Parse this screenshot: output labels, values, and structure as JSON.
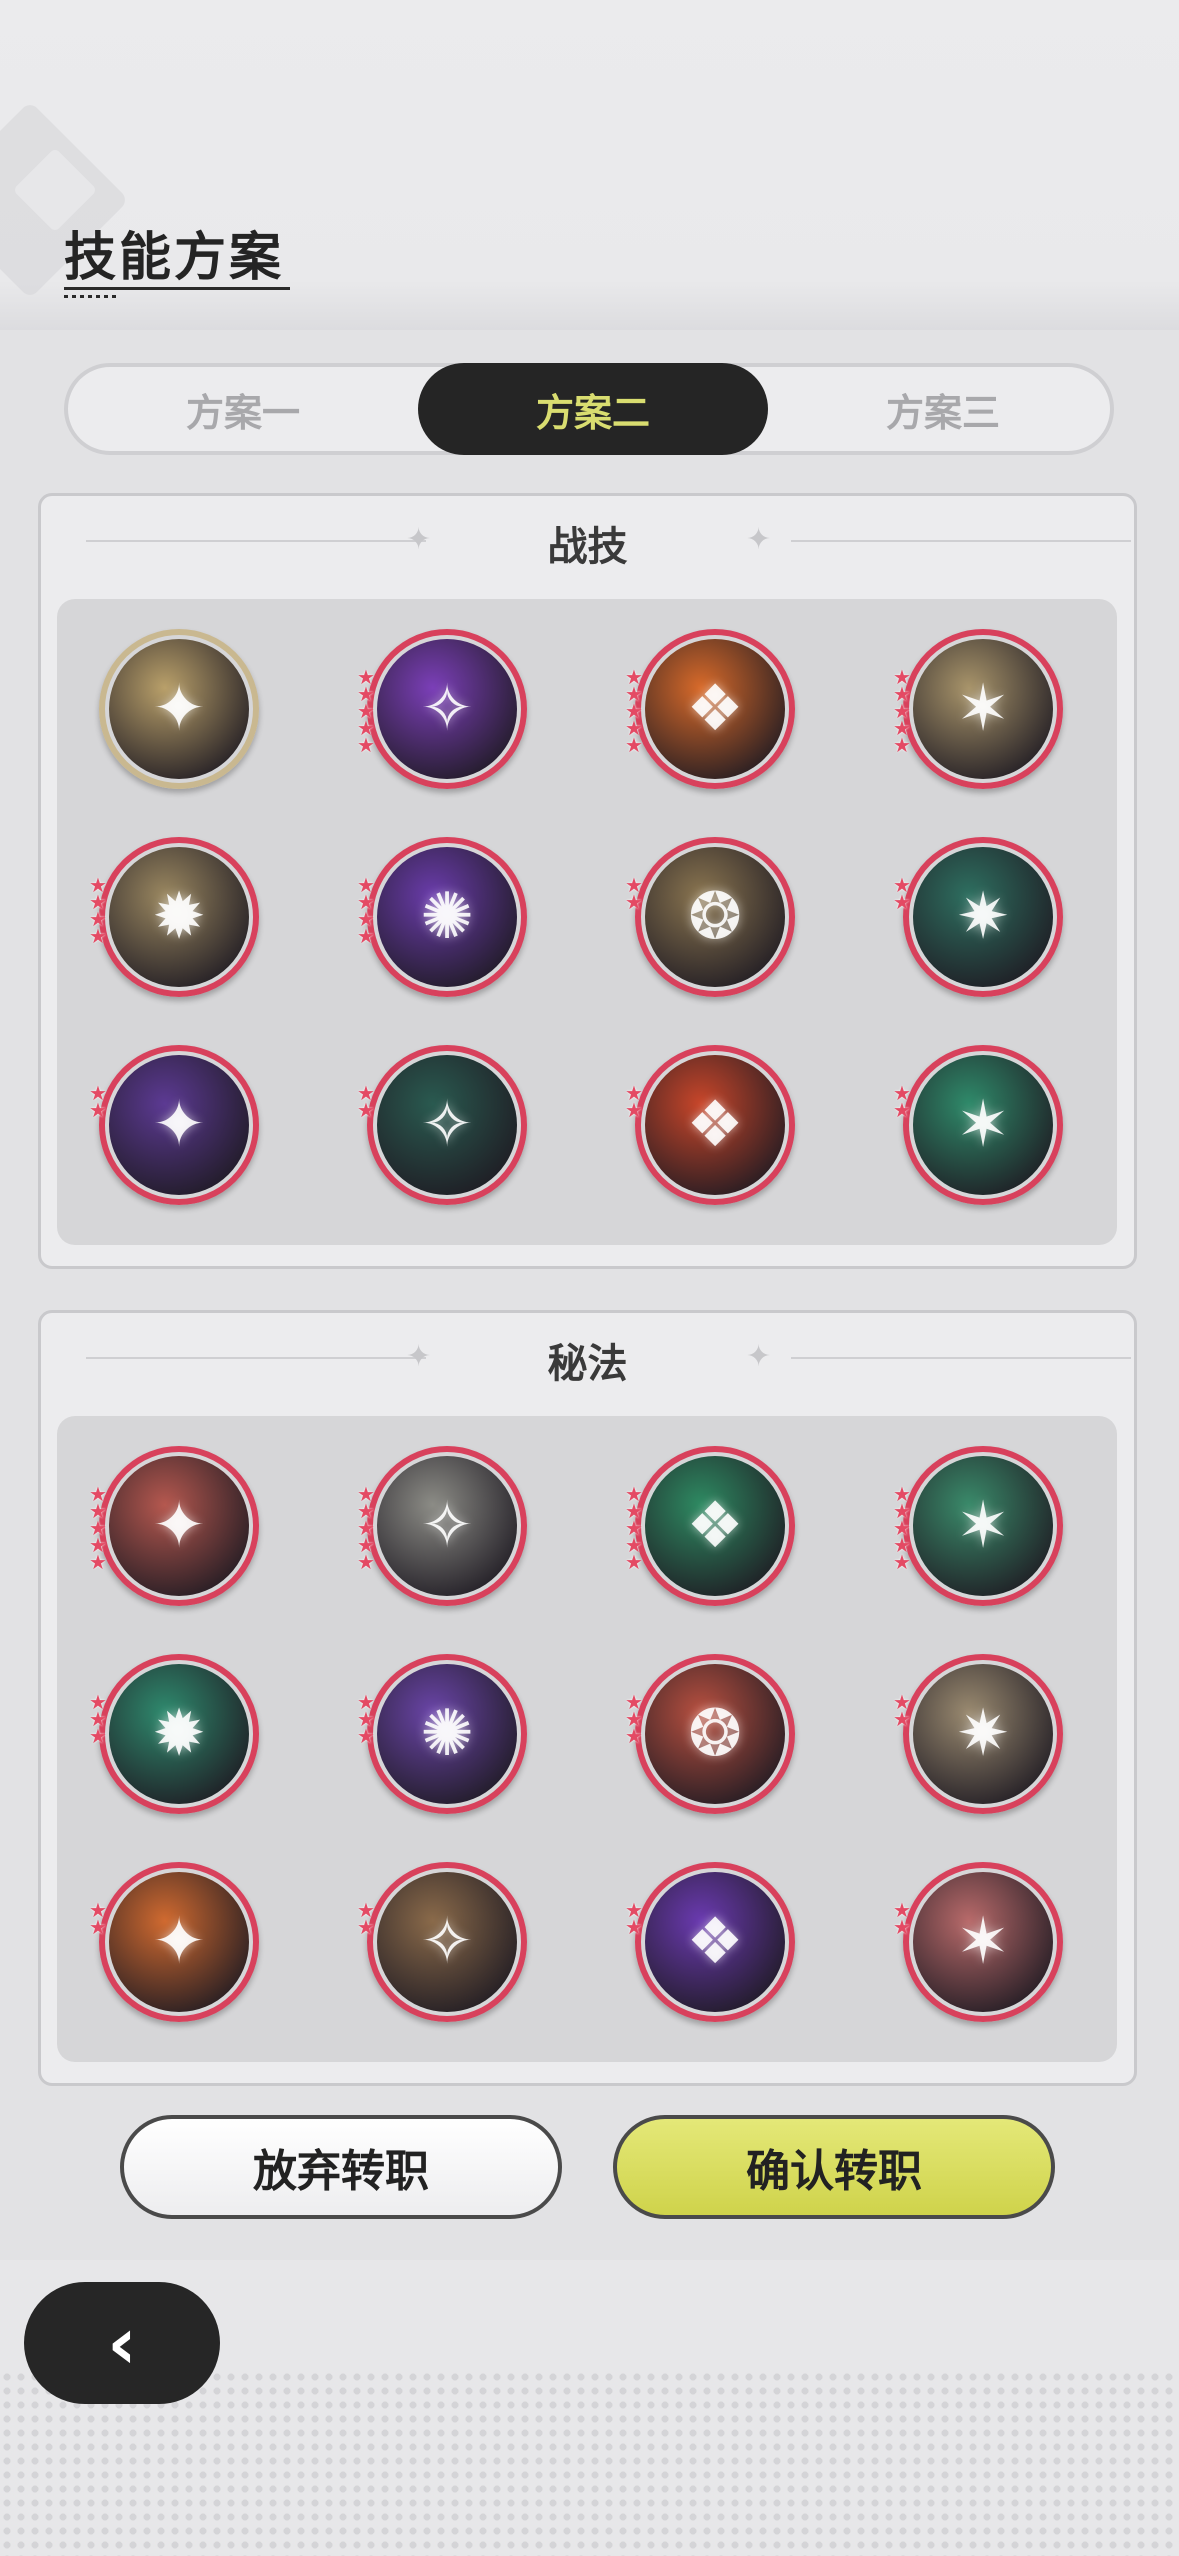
{
  "header": {
    "title": "技能方案"
  },
  "tabs": [
    {
      "label": "方案一",
      "active": false
    },
    {
      "label": "方案二",
      "active": true
    },
    {
      "label": "方案三",
      "active": false
    }
  ],
  "combat_section": {
    "title": "战技",
    "skills": [
      {
        "icon": "gold-crescent-slash-icon",
        "stars": 0,
        "color": "#b9a06a"
      },
      {
        "icon": "purple-heart-burst-icon",
        "stars": 5,
        "color": "#7b3fb8"
      },
      {
        "icon": "fire-tornado-icon",
        "stars": 5,
        "color": "#d86a2a"
      },
      {
        "icon": "gold-star-burst-icon",
        "stars": 5,
        "color": "#a8946a"
      },
      {
        "icon": "gold-spikes-icon",
        "stars": 4,
        "color": "#9a8760"
      },
      {
        "icon": "purple-star-slash-icon",
        "stars": 4,
        "color": "#6a3cab"
      },
      {
        "icon": "gold-eruption-icon",
        "stars": 2,
        "color": "#8a7550"
      },
      {
        "icon": "green-crescent-icon",
        "stars": 2,
        "color": "#2e6f60"
      },
      {
        "icon": "purple-claw-icon",
        "stars": 2,
        "color": "#5c3a93"
      },
      {
        "icon": "green-web-icon",
        "stars": 2,
        "color": "#2a5a50"
      },
      {
        "icon": "fire-slash-icon",
        "stars": 2,
        "color": "#c8462a"
      },
      {
        "icon": "green-barrier-arrows-icon",
        "stars": 2,
        "color": "#2f8a6a"
      }
    ]
  },
  "arcane_section": {
    "title": "秘法",
    "skills": [
      {
        "icon": "red-strike-icon",
        "stars": 5,
        "color": "#b5584f"
      },
      {
        "icon": "white-warrior-icon",
        "stars": 5,
        "color": "#8c8c86"
      },
      {
        "icon": "green-leaf-blade-icon",
        "stars": 5,
        "color": "#2e8a62"
      },
      {
        "icon": "green-swirl-arrows-icon",
        "stars": 5,
        "color": "#3a8a6a"
      },
      {
        "icon": "green-lotus-icon",
        "stars": 3,
        "color": "#2f8a6e"
      },
      {
        "icon": "purple-figure-icon",
        "stars": 3,
        "color": "#6a45a8"
      },
      {
        "icon": "red-flame-icon",
        "stars": 3,
        "color": "#b85040"
      },
      {
        "icon": "gold-leaf-icon",
        "stars": 2,
        "color": "#9a8a70"
      },
      {
        "icon": "orange-fire-figure-icon",
        "stars": 2,
        "color": "#d06a30"
      },
      {
        "icon": "heart-shield-icon",
        "stars": 2,
        "color": "#8a6a4a"
      },
      {
        "icon": "purple-fire-icon",
        "stars": 2,
        "color": "#6a3ab0"
      },
      {
        "icon": "red-wind-icon",
        "stars": 2,
        "color": "#b86a6a"
      }
    ]
  },
  "buttons": {
    "cancel": "放弃转职",
    "confirm": "确认转职"
  },
  "back": {
    "icon": "chevron-left-icon",
    "glyph": "‹"
  }
}
